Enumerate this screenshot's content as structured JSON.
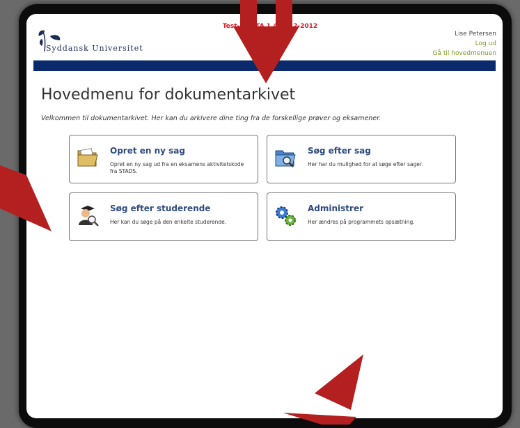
{
  "header": {
    "university_name": "Syddansk Universitet",
    "test_banner": "Test-.. BETA 1,4.  4/12-2012",
    "user_name": "Lise Petersen",
    "logout_link": "Log ud",
    "main_menu_link": "Gå til hovedmenuen"
  },
  "page": {
    "title": "Hovedmenu for dokumentarkivet",
    "welcome": "Velkommen til dokumentarkivet. Her kan du arkivere dine ting fra de forskellige prøver og eksamener."
  },
  "cards": [
    {
      "title": "Opret en ny sag",
      "description": "Opret en ny sag ud fra en eksamens aktivitetskode fra STADS.",
      "icon": "folder-icon"
    },
    {
      "title": "Søg efter sag",
      "description": "Her har du mulighed for at søge efter sager.",
      "icon": "folder-search-icon"
    },
    {
      "title": "Søg efter studerende",
      "description": "Her kan du søge på den enkelte studerende.",
      "icon": "student-search-icon"
    },
    {
      "title": "Administrer",
      "description": "Her ændres på programmets opsætning.",
      "icon": "gears-icon"
    }
  ],
  "colors": {
    "accent_blue": "#0a2a6b",
    "title_blue": "#2f4c80",
    "link_green": "#7a9a1a",
    "banner_red": "#e01020",
    "annotation_arrow": "#b4201f"
  }
}
